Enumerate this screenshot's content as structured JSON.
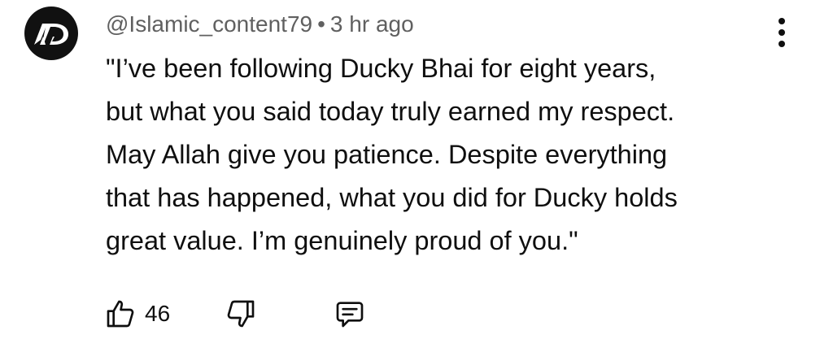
{
  "comment": {
    "author": "@Islamic_content79",
    "separator": "•",
    "time": "3 hr ago",
    "avatar_text": "AD",
    "lines": [
      "\"I’ve been following Ducky Bhai for eight years,",
      "but what you said today truly earned my respect.",
      "May Allah give you patience. Despite everything",
      "that has happened, what you did for Ducky holds",
      "great value. I’m genuinely proud of you.\""
    ],
    "like_count": "46"
  },
  "icons": {
    "more": "more-vertical-icon",
    "like": "thumb-up-icon",
    "dislike": "thumb-down-icon",
    "reply": "comment-reply-icon"
  },
  "colors": {
    "text": "#0f0f0f",
    "meta": "#606060",
    "avatar_bg": "#111111"
  }
}
